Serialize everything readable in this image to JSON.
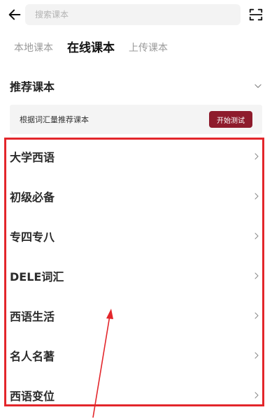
{
  "header": {
    "search_placeholder": "搜索课本",
    "back_icon": "back-arrow-icon",
    "scan_icon": "scan-icon"
  },
  "tabs": [
    {
      "label": "本地课本",
      "active": false
    },
    {
      "label": "在线课本",
      "active": true
    },
    {
      "label": "上传课本",
      "active": false
    }
  ],
  "recommend": {
    "title": "推荐课本",
    "text": "根据词汇量推荐课本",
    "button_label": "开始测试"
  },
  "courses": [
    {
      "label": "大学西语"
    },
    {
      "label": "初级必备"
    },
    {
      "label": "专四专八"
    },
    {
      "label": "DELE词汇"
    },
    {
      "label": "西语生活"
    },
    {
      "label": "名人名著"
    },
    {
      "label": "西语变位"
    }
  ],
  "colors": {
    "accent": "#8e1b2c",
    "annotation": "#e3262b",
    "banner_bg": "#f4f4f4",
    "search_bg": "#f3f3f3"
  }
}
